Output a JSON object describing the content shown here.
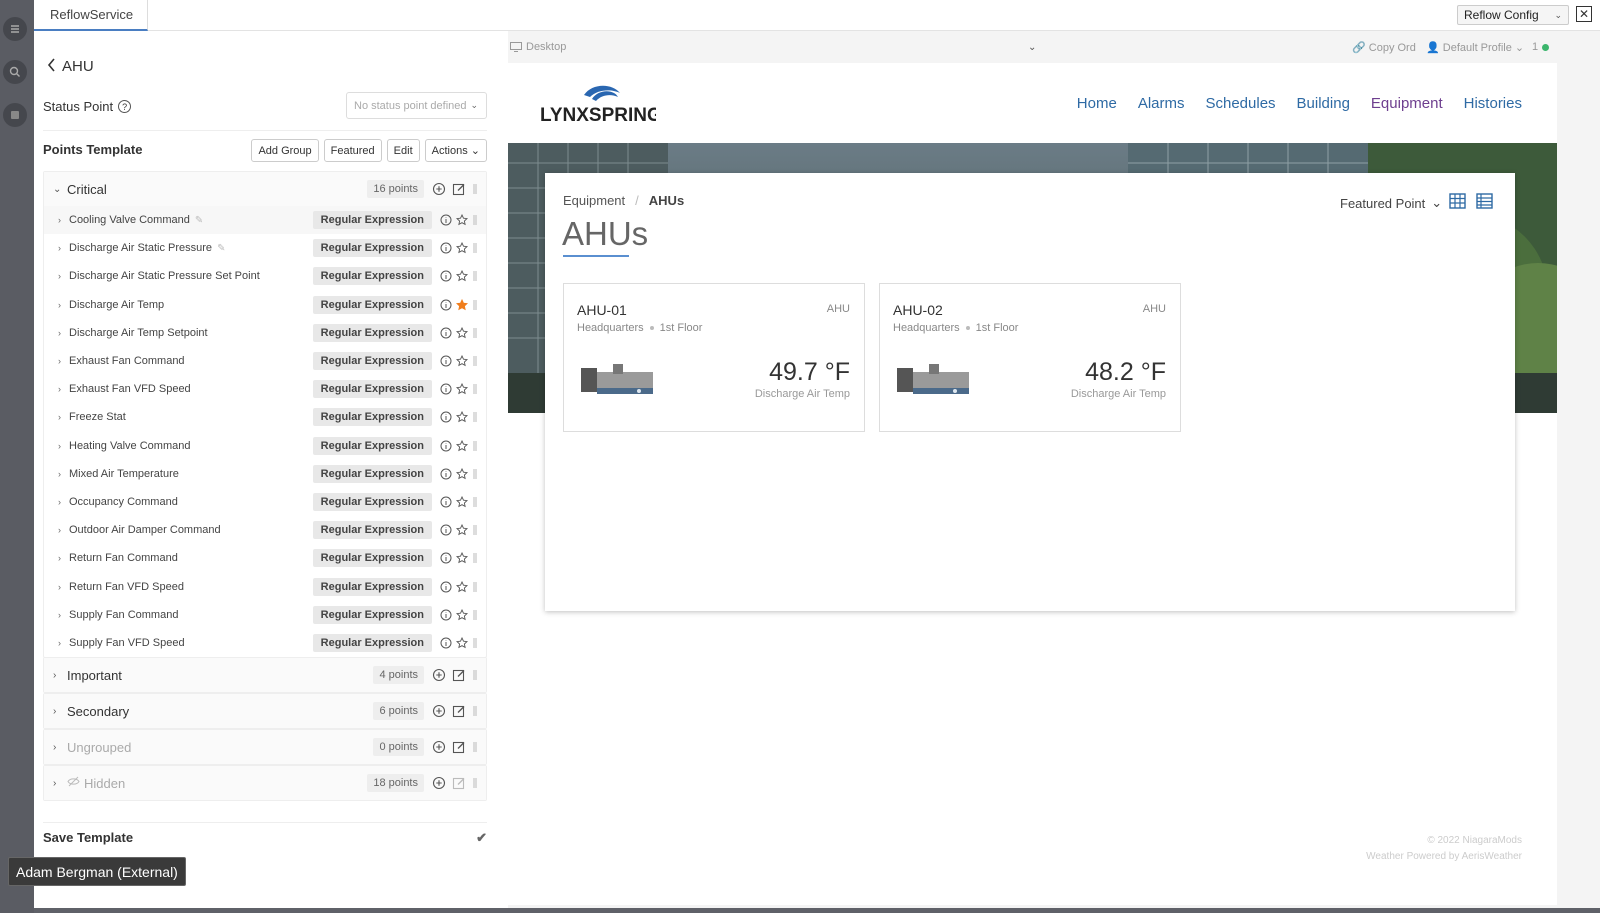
{
  "window": {
    "tab_title": "ReflowService",
    "config_select": "Reflow Config",
    "close_glyph": "✕"
  },
  "left_panel": {
    "back_label": "AHU",
    "status_point_label": "Status Point",
    "status_select_placeholder": "No status point defined",
    "points_template_label": "Points Template",
    "buttons": {
      "add_group": "Add Group",
      "featured": "Featured",
      "edit": "Edit",
      "actions": "Actions"
    },
    "groups": [
      {
        "name": "Critical",
        "count": "16 points"
      },
      {
        "name": "Important",
        "count": "4 points"
      },
      {
        "name": "Secondary",
        "count": "6 points"
      },
      {
        "name": "Ungrouped",
        "count": "0 points"
      },
      {
        "name": "Hidden",
        "count": "18 points"
      }
    ],
    "critical_points": [
      {
        "label": "Cooling Valve Command",
        "match": "Regular Expression",
        "featured": false
      },
      {
        "label": "Discharge Air Static Pressure",
        "match": "Regular Expression",
        "featured": false
      },
      {
        "label": "Discharge Air Static Pressure Set Point",
        "match": "Regular Expression",
        "featured": false
      },
      {
        "label": "Discharge Air Temp",
        "match": "Regular Expression",
        "featured": true
      },
      {
        "label": "Discharge Air Temp Setpoint",
        "match": "Regular Expression",
        "featured": false
      },
      {
        "label": "Exhaust Fan Command",
        "match": "Regular Expression",
        "featured": false
      },
      {
        "label": "Exhaust Fan VFD Speed",
        "match": "Regular Expression",
        "featured": false
      },
      {
        "label": "Freeze Stat",
        "match": "Regular Expression",
        "featured": false
      },
      {
        "label": "Heating Valve Command",
        "match": "Regular Expression",
        "featured": false
      },
      {
        "label": "Mixed Air Temperature",
        "match": "Regular Expression",
        "featured": false
      },
      {
        "label": "Occupancy Command",
        "match": "Regular Expression",
        "featured": false
      },
      {
        "label": "Outdoor Air Damper Command",
        "match": "Regular Expression",
        "featured": false
      },
      {
        "label": "Return Fan Command",
        "match": "Regular Expression",
        "featured": false
      },
      {
        "label": "Return Fan VFD Speed",
        "match": "Regular Expression",
        "featured": false
      },
      {
        "label": "Supply Fan Command",
        "match": "Regular Expression",
        "featured": false
      },
      {
        "label": "Supply Fan VFD Speed",
        "match": "Regular Expression",
        "featured": false
      }
    ],
    "save_template": "Save Template"
  },
  "user_badge": "Adam Bergman (External)",
  "preview_bar": {
    "device": "Desktop",
    "copy_ord": "Copy Ord",
    "profile": "Default Profile",
    "count": "1"
  },
  "site": {
    "logo_text": "LYNXSPRING",
    "nav": [
      "Home",
      "Alarms",
      "Schedules",
      "Building",
      "Equipment",
      "Histories"
    ],
    "active_nav": "Equipment",
    "breadcrumb": {
      "root": "Equipment",
      "sep": "/",
      "current": "AHUs"
    },
    "heading": "AHUs",
    "featured_point_select": "Featured Point",
    "cards": [
      {
        "name": "AHU-01",
        "type": "AHU",
        "location": "Headquarters",
        "floor": "1st Floor",
        "value": "49.7 °F",
        "point": "Discharge Air Temp"
      },
      {
        "name": "AHU-02",
        "type": "AHU",
        "location": "Headquarters",
        "floor": "1st Floor",
        "value": "48.2 °F",
        "point": "Discharge Air Temp"
      }
    ],
    "footer_copyright": "© 2022 NiagaraMods",
    "footer_weather": "Weather Powered by AerisWeather"
  },
  "colors": {
    "nav_link": "#2e6aa4",
    "nav_active": "#6e3f8f",
    "star_active": "#f07d1c",
    "accent": "#4a7ec2"
  }
}
